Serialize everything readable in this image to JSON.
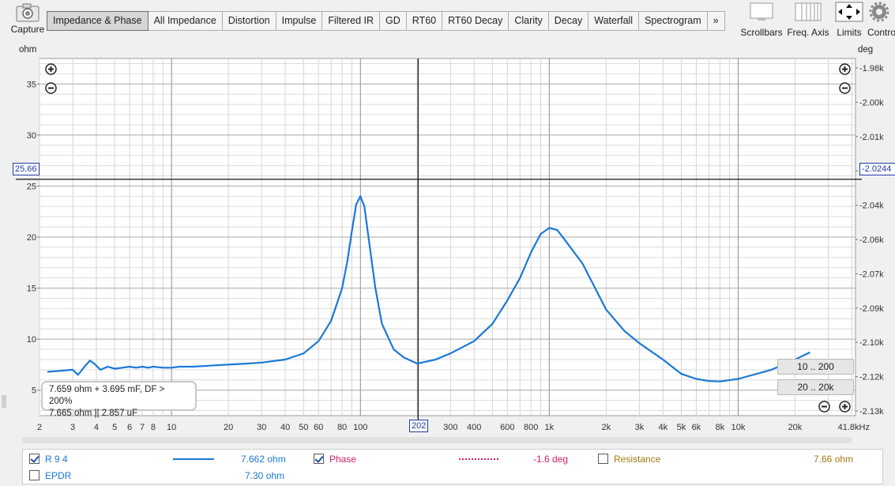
{
  "toolbar": {
    "capture_label": "Capture",
    "tabs": [
      "Impedance & Phase",
      "All Impedance",
      "Distortion",
      "Impulse",
      "Filtered IR",
      "GD",
      "RT60",
      "RT60 Decay",
      "Clarity",
      "Decay",
      "Waterfall",
      "Spectrogram",
      "»"
    ],
    "active_tab": "Impedance & Phase",
    "tools": [
      "Scrollbars",
      "Freq. Axis",
      "Limits",
      "Contro"
    ]
  },
  "plot": {
    "left_unit": "ohm",
    "right_unit": "deg",
    "cursor_y_left": "25.66",
    "cursor_y_right": "-2.0244",
    "cursor_x": "202",
    "readout_line1": "7.659 ohm + 3.695 mF, DF > 200%",
    "readout_line2": "7.665 ohm || 2.857 uF",
    "range_buttons": [
      "10 .. 200",
      "20 .. 20k"
    ]
  },
  "legend": {
    "items": [
      {
        "label": "R 9 4",
        "value": "7.662 ohm",
        "checked": true,
        "color": "#1a78d8"
      },
      {
        "label": "Phase",
        "value": "-1.6 deg",
        "checked": true,
        "color": "#d0206a"
      },
      {
        "label": "Resistance",
        "value": "7.66 ohm",
        "checked": false,
        "color": "#a07a10"
      },
      {
        "label": "EPDR",
        "value": "7.30 ohm",
        "checked": false,
        "color": "#1a78d8"
      }
    ]
  },
  "chart_data": {
    "type": "line",
    "xscale": "log",
    "xlim": [
      2,
      41800
    ],
    "ylim": [
      2.5,
      37.5
    ],
    "ylim_right_labels": [
      "-1.98k",
      "-2.00k",
      "-2.01k",
      "-2.03k",
      "-2.04k",
      "-2.06k",
      "-2.07k",
      "-2.09k",
      "-2.10k",
      "-2.12k",
      "-2.13k"
    ],
    "y_ticks": [
      5,
      10,
      15,
      20,
      25,
      30,
      35
    ],
    "x_tick_labels": [
      "2",
      "3",
      "4",
      "5",
      "6",
      "7",
      "8",
      "10",
      "20",
      "30",
      "40",
      "50",
      "60",
      "80",
      "100",
      "200",
      "300",
      "400",
      "600",
      "800",
      "1k",
      "2k",
      "3k",
      "4k",
      "5k",
      "6k",
      "8k",
      "10k",
      "20k",
      "41.8kHz"
    ],
    "x_tick_values": [
      2,
      3,
      4,
      5,
      6,
      7,
      8,
      10,
      20,
      30,
      40,
      50,
      60,
      80,
      100,
      200,
      300,
      400,
      600,
      800,
      1000,
      2000,
      3000,
      4000,
      5000,
      6000,
      8000,
      10000,
      20000,
      41800
    ],
    "grid": true,
    "series": [
      {
        "name": "R 9 4",
        "color": "#1a78d8",
        "x": [
          2.2,
          2.6,
          3.0,
          3.2,
          3.5,
          3.7,
          3.9,
          4.2,
          4.6,
          5.0,
          5.5,
          6.0,
          6.5,
          7.0,
          7.5,
          8.0,
          9.0,
          10.0,
          11.0,
          13.0,
          16.0,
          20.0,
          25.0,
          30.0,
          40.0,
          50.0,
          60.0,
          70.0,
          80.0,
          85.0,
          90.0,
          95.0,
          100.0,
          105.0,
          110.0,
          120.0,
          130.0,
          150.0,
          170.0,
          200.0,
          250.0,
          300.0,
          400.0,
          500.0,
          600.0,
          700.0,
          800.0,
          900.0,
          1000.0,
          1100.0,
          1200.0,
          1500.0,
          2000.0,
          2500.0,
          3000.0,
          4000.0,
          5000.0,
          6000.0,
          7000.0,
          8000.0,
          10000.0,
          15000.0,
          20000.0,
          24000.0
        ],
        "y": [
          6.8,
          6.9,
          7.0,
          6.5,
          7.4,
          7.9,
          7.6,
          7.0,
          7.3,
          7.1,
          7.2,
          7.3,
          7.2,
          7.3,
          7.2,
          7.3,
          7.2,
          7.2,
          7.3,
          7.3,
          7.4,
          7.5,
          7.6,
          7.7,
          8.0,
          8.6,
          9.8,
          11.8,
          15.0,
          17.5,
          20.5,
          23.2,
          24.0,
          23.0,
          20.2,
          15.0,
          11.5,
          9.0,
          8.2,
          7.6,
          8.0,
          8.6,
          9.8,
          11.5,
          13.8,
          16.0,
          18.5,
          20.3,
          20.9,
          20.7,
          19.8,
          17.4,
          12.9,
          10.8,
          9.6,
          8.0,
          6.6,
          6.1,
          5.9,
          5.85,
          6.1,
          7.0,
          8.0,
          8.7
        ]
      }
    ]
  }
}
